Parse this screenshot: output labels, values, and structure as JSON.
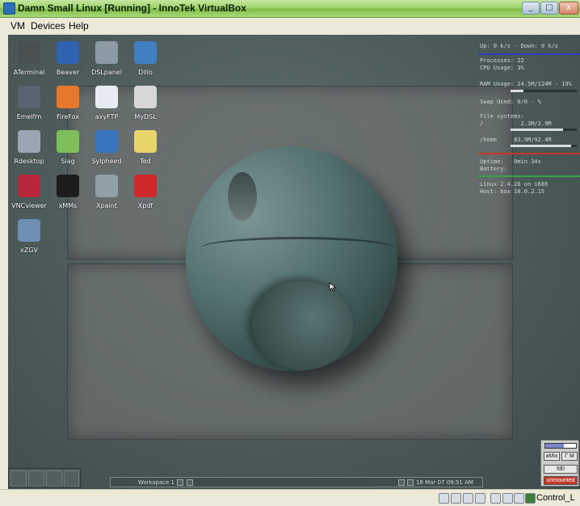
{
  "window": {
    "title": "Damn Small Linux [Running] - InnoTek VirtualBox",
    "controls": [
      "_",
      "□",
      "x"
    ]
  },
  "menu": [
    {
      "label": "VM"
    },
    {
      "label": "Devices"
    },
    {
      "label": "Help"
    }
  ],
  "desktop_icons": [
    {
      "label": "ATerminal",
      "icon": "terminal-icon",
      "color": "#4a4f4f"
    },
    {
      "label": "Beaver",
      "icon": "brush-icon",
      "color": "#2f63b0"
    },
    {
      "label": "DSLpanel",
      "icon": "control-panel-icon",
      "color": "#8c9aa6"
    },
    {
      "label": "Dillo",
      "icon": "globe-icon",
      "color": "#3f7fc2"
    },
    {
      "label": "Emelfm",
      "icon": "file-manager-icon",
      "color": "#5a6470"
    },
    {
      "label": "FireFox",
      "icon": "firefox-icon",
      "color": "#e6772b"
    },
    {
      "label": "axyFTP",
      "icon": "ftp-icon",
      "color": "#e6ecf2"
    },
    {
      "label": "MyDSL",
      "icon": "gears-icon",
      "color": "#d7d7d7"
    },
    {
      "label": "Rdesktop",
      "icon": "desktop-icon",
      "color": "#9aa7b3"
    },
    {
      "label": "Siag",
      "icon": "spreadsheet-icon",
      "color": "#7fbf5a"
    },
    {
      "label": "Sylpheed",
      "icon": "mail-icon",
      "color": "#3a76c0"
    },
    {
      "label": "Ted",
      "icon": "pen-icon",
      "color": "#e8d56a"
    },
    {
      "label": "VNCviewer",
      "icon": "vnc-icon",
      "color": "#b8283a"
    },
    {
      "label": "xMMs",
      "icon": "penguin-icon",
      "color": "#1d1d1d"
    },
    {
      "label": "Xpaint",
      "icon": "paint-icon",
      "color": "#8fa0a6"
    },
    {
      "label": "Xpdf",
      "icon": "pdf-icon",
      "color": "#cf2a2a"
    },
    {
      "label": "xZGV",
      "icon": "image-viewer-icon",
      "color": "#6e8fb3"
    }
  ],
  "monitor": {
    "net": "Up: 0 k/s - Down: 0 k/s",
    "processes": "Processes: 22",
    "cpu": "CPU Usage: 3%",
    "ram": "RAM Usage: 24.5M/124M - 19%",
    "swap": "Swap Used: 0/0 - %",
    "fs_label": "File systems:",
    "fs_root": "/           2.3M/2.9M",
    "fs_home": "/home     83.9M/92.4M",
    "uptime": "Uptime:   0min 34s",
    "battery": "Battery:",
    "kernel": "Linux 2.4.26 on i686",
    "host": "Host: box 10.0.2.15",
    "ram_fraction": 0.19,
    "root_fraction": 0.79,
    "home_fraction": 0.91,
    "accent_blue": "#2d3fbf",
    "accent_red": "#c0392b",
    "accent_green": "#3aa04a"
  },
  "taskbar": {
    "workspace": "Workspace 1",
    "clock": "18 Mar 07 09:51 AM"
  },
  "dock": {
    "mixer": "aMix",
    "mixer2": "Γ M",
    "fd": "fd0",
    "mount": "unmounted"
  },
  "statusbar": {
    "host_key": "Control_L"
  }
}
